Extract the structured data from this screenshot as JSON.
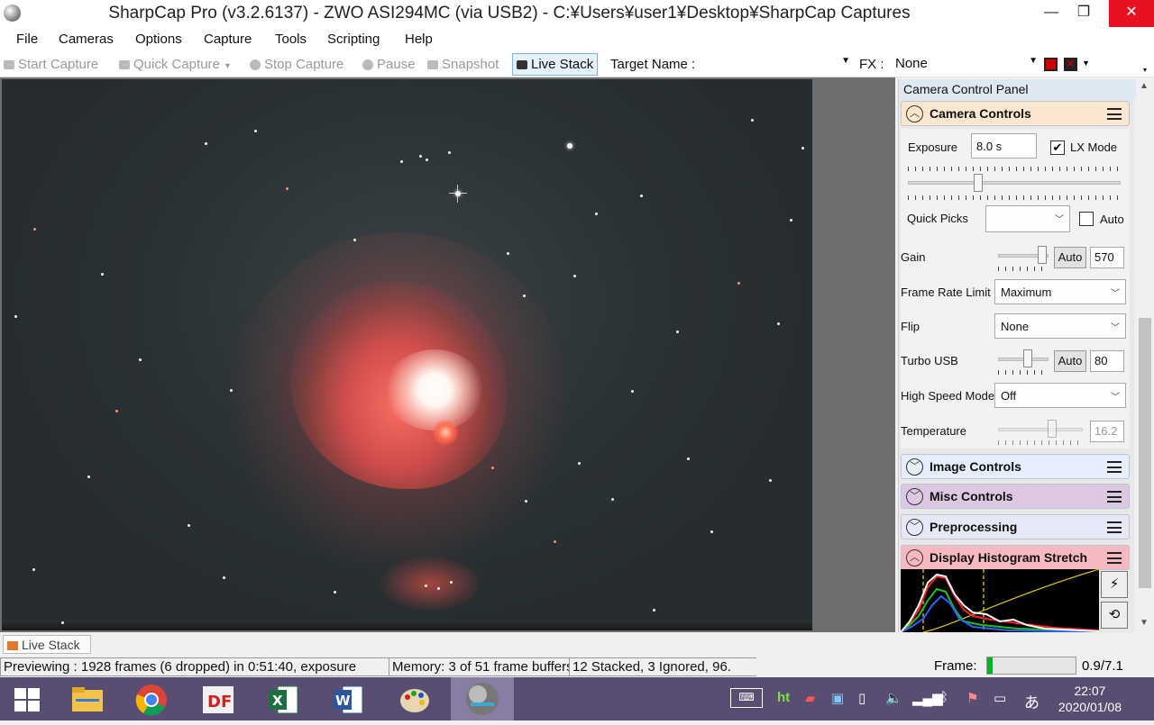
{
  "window": {
    "title": "SharpCap Pro (v3.2.6137) - ZWO ASI294MC (via USB2) - C:¥Users¥user1¥Desktop¥SharpCap Captures",
    "minimize": "—",
    "maximize": "❐",
    "close": "✕"
  },
  "menu": [
    "File",
    "Cameras",
    "Options",
    "Capture",
    "Tools",
    "Scripting",
    "Help"
  ],
  "toolbar": {
    "start_capture": "Start Capture",
    "quick_capture": "Quick Capture",
    "stop_capture": "Stop Capture",
    "pause": "Pause",
    "snapshot": "Snapshot",
    "live_stack": "Live Stack",
    "target_name_label": "Target Name :",
    "target_name_value": "",
    "fx_label": "FX :",
    "fx_value": "None"
  },
  "panel": {
    "title": "Camera Control Panel",
    "camera_controls": {
      "title": "Camera Controls",
      "exposure_label": "Exposure",
      "exposure_value": "8.0 s",
      "lx_mode_label": "LX Mode",
      "lx_mode_checked": "✔",
      "quick_picks_label": "Quick Picks",
      "quick_picks_value": "",
      "auto_label": "Auto",
      "gain_label": "Gain",
      "gain_auto": "Auto",
      "gain_value": "570",
      "frame_rate_label": "Frame Rate Limit",
      "frame_rate_value": "Maximum",
      "flip_label": "Flip",
      "flip_value": "None",
      "turbo_usb_label": "Turbo USB",
      "turbo_auto": "Auto",
      "turbo_value": "80",
      "high_speed_label": "High Speed Mode",
      "high_speed_value": "Off",
      "temperature_label": "Temperature",
      "temperature_value": "16.2"
    },
    "image_controls": "Image Controls",
    "misc_controls": "Misc Controls",
    "preprocessing": "Preprocessing",
    "histogram": "Display Histogram Stretch"
  },
  "colors": {
    "camera_controls_bg": "#fbe6cf",
    "image_controls_bg": "#e6eefb",
    "misc_controls_bg": "#dcc8e0",
    "preprocessing_bg": "#e6e8f8",
    "histogram_bg": "#f6b9c0"
  },
  "tabs": {
    "live_stack": "Live Stack"
  },
  "status": {
    "previewing": "Previewing : 1928 frames (6 dropped) in 0:51:40, exposure",
    "memory": "Memory: 3 of 51 frame buffers",
    "stacked": "12 Stacked, 3 Ignored, 96.",
    "frame_label": "Frame:",
    "frame_progress": 0.06,
    "frame_value": "0.9/7.1"
  },
  "taskbar": {
    "icons": [
      "windows-start",
      "file-explorer",
      "chrome",
      "deepskystacker",
      "excel",
      "word",
      "paint",
      "sharpcap"
    ],
    "tray_text_ime": "あ",
    "time": "22:07",
    "date": "2020/01/08"
  }
}
